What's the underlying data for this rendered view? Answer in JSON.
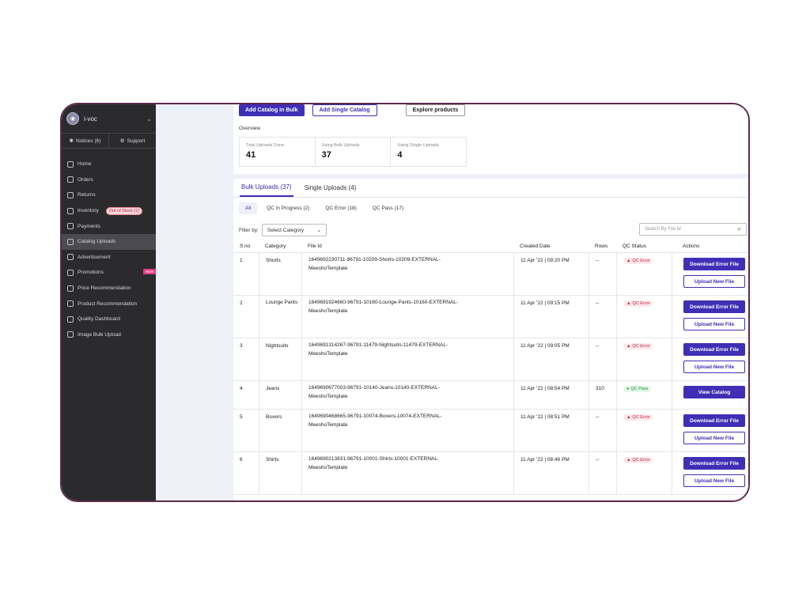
{
  "sidebar": {
    "account_name": "i-voc",
    "notices_label": "Notices (6)",
    "support_label": "Support",
    "items": [
      {
        "label": "Home",
        "icon": "home-icon"
      },
      {
        "label": "Orders",
        "icon": "orders-icon"
      },
      {
        "label": "Returns",
        "icon": "returns-icon"
      },
      {
        "label": "Inventory",
        "icon": "inventory-icon",
        "badge": "Out of Stock (1)"
      },
      {
        "label": "Payments",
        "icon": "payments-icon"
      },
      {
        "label": "Catalog Uploads",
        "icon": "upload-icon",
        "active": true
      },
      {
        "label": "Advertisement",
        "icon": "megaphone-icon"
      },
      {
        "label": "Promotions",
        "icon": "promotions-icon",
        "badge_new": "NEW"
      },
      {
        "label": "Price Recommendation",
        "icon": "price-icon"
      },
      {
        "label": "Product Recommendation",
        "icon": "product-icon"
      },
      {
        "label": "Quality Dashboard",
        "icon": "quality-icon"
      },
      {
        "label": "Image Bulk Upload",
        "icon": "image-icon"
      }
    ]
  },
  "actions": {
    "add_bulk": "Add Catalog in Bulk",
    "add_single": "Add Single Catalog",
    "explore": "Explore products"
  },
  "overview": {
    "title": "Overview",
    "total_label": "Total Uploads Done",
    "total_value": "41",
    "bulk_label": "Using Bulk Uploads",
    "bulk_value": "37",
    "single_label": "Using Single Uploads",
    "single_value": "4"
  },
  "tabs": {
    "bulk": "Bulk Uploads (37)",
    "single": "Single Uploads (4)"
  },
  "subtabs": {
    "all": "All",
    "in_progress": "QC in Progress (2)",
    "error": "QC Error (18)",
    "pass": "QC Pass (17)"
  },
  "filter": {
    "label": "Filter by:",
    "select_value": "Select Category",
    "search_placeholder": "Search By File Id"
  },
  "table": {
    "headers": {
      "sno": "S.no",
      "category": "Category",
      "file_id": "File Id",
      "created": "Created Date",
      "rows": "Rows",
      "qc": "QC Status",
      "actions": "Actions"
    },
    "rows": [
      {
        "sno": "1",
        "category": "Shorts",
        "file_line1": "1649692230711-96791-10209-Shorts-10209-EXTERNAL-",
        "file_line2": "MeeshoTemplate",
        "date": "11 Apr '22 | 09:20 PM",
        "rows": "--",
        "qc": "QC Error",
        "btn1": "Download Error File",
        "btn2": "Upload New File"
      },
      {
        "sno": "2",
        "category": "Lounge Pants",
        "file_line1": "1649691924660-96791-10160-Lounge-Pants-10160-EXTERNAL-",
        "file_line2": "MeeshoTemplate",
        "date": "11 Apr '22 | 09:15 PM",
        "rows": "--",
        "qc": "QC Error",
        "btn1": "Download Error File",
        "btn2": "Upload New File"
      },
      {
        "sno": "3",
        "category": "Nightsuits",
        "file_line1": "1649691314267-96791-11479-Nightsuits-11479-EXTERNAL-",
        "file_line2": "MeeshoTemplate",
        "date": "11 Apr '22 | 09:05 PM",
        "rows": "--",
        "qc": "QC Error",
        "btn1": "Download Error File",
        "btn2": "Upload New File"
      },
      {
        "sno": "4",
        "category": "Jeans",
        "file_line1": "1649690677003-96791-10140-Jeans-10140-EXTERNAL-",
        "file_line2": "MeeshoTemplate",
        "date": "11 Apr '22 | 08:54 PM",
        "rows": "310",
        "qc": "QC Pass",
        "btn1": "View Catalog",
        "btn2": ""
      },
      {
        "sno": "5",
        "category": "Boxers",
        "file_line1": "1649690468665-96791-10074-Boxers-10074-EXTERNAL-",
        "file_line2": "MeeshoTemplate",
        "date": "11 Apr '22 | 08:51 PM",
        "rows": "--",
        "qc": "QC Error",
        "btn1": "Download Error File",
        "btn2": "Upload New File"
      },
      {
        "sno": "6",
        "category": "Shirts",
        "file_line1": "1649690213831-96791-10001-Shirts-10001-EXTERNAL-",
        "file_line2": "MeeshoTemplate",
        "date": "11 Apr '22 | 08:46 PM",
        "rows": "--",
        "qc": "QC Error",
        "btn1": "Download Error File",
        "btn2": "Upload New File"
      }
    ]
  }
}
